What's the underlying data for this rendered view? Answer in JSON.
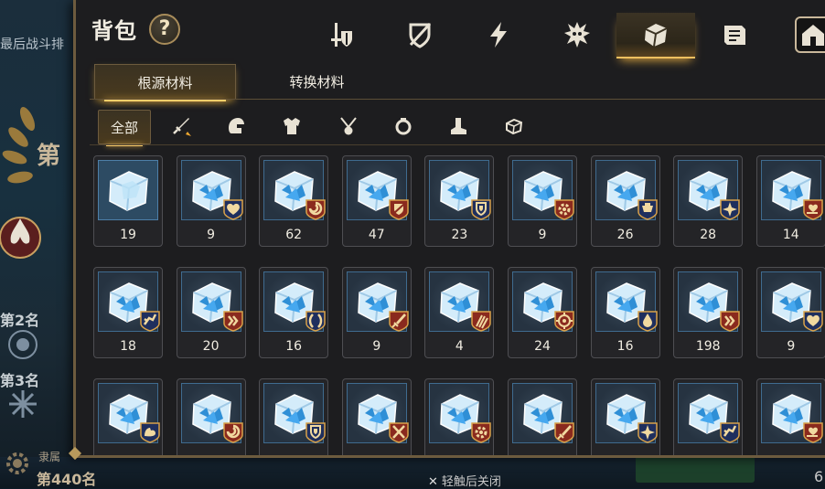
{
  "background": {
    "left_title": "最后战斗排",
    "first_place": "第",
    "rank2_label": "第2名",
    "rank3_label": "第3名",
    "self_name": "隶属",
    "self_rank": "第440名",
    "right_number": "6",
    "close_hint": "轻触后关闭"
  },
  "header": {
    "title": "背包",
    "help_label": "?",
    "tabs": [
      {
        "icon": "sword-shield-icon",
        "active": false
      },
      {
        "icon": "broken-shield-icon",
        "active": false
      },
      {
        "icon": "lightning-icon",
        "active": false
      },
      {
        "icon": "spiky-creature-icon",
        "active": false
      },
      {
        "icon": "material-cube-icon",
        "active": true
      },
      {
        "icon": "scroll-box-icon",
        "active": false
      },
      {
        "icon": "house-icon",
        "active": false
      }
    ]
  },
  "sub_tabs": [
    {
      "label": "根源材料",
      "active": true
    },
    {
      "label": "转换材料",
      "active": false
    }
  ],
  "filters": {
    "all_label": "全部",
    "icons": [
      "sword-filter-icon",
      "helmet-filter-icon",
      "armor-filter-icon",
      "necklace-filter-icon",
      "ring-filter-icon",
      "boots-filter-icon",
      "material-filter-icon"
    ]
  },
  "items": [
    {
      "count": "19",
      "badge": "none"
    },
    {
      "count": "9",
      "badge": "heart-icon"
    },
    {
      "count": "62",
      "badge": "swirl-icon"
    },
    {
      "count": "47",
      "badge": "shield-slash-icon"
    },
    {
      "count": "23",
      "badge": "shield-icon"
    },
    {
      "count": "9",
      "badge": "gear-icon"
    },
    {
      "count": "26",
      "badge": "ship-icon"
    },
    {
      "count": "28",
      "badge": "star-icon"
    },
    {
      "count": "14",
      "badge": "heart-hand-icon"
    },
    {
      "count": "18",
      "badge": "sprint-icon"
    },
    {
      "count": "20",
      "badge": "double-chevron-icon"
    },
    {
      "count": "16",
      "badge": "parry-icon"
    },
    {
      "count": "9",
      "badge": "sword-strike-icon"
    },
    {
      "count": "4",
      "badge": "claw-icon"
    },
    {
      "count": "24",
      "badge": "target-icon"
    },
    {
      "count": "16",
      "badge": "water-drop-icon"
    },
    {
      "count": "198",
      "badge": "double-chevron-icon"
    },
    {
      "count": "9",
      "badge": "heart-icon"
    },
    {
      "count": "",
      "badge": "muscle-icon"
    },
    {
      "count": "",
      "badge": "swirl-icon"
    },
    {
      "count": "",
      "badge": "shield-icon"
    },
    {
      "count": "",
      "badge": "crossed-swords-icon"
    },
    {
      "count": "",
      "badge": "gear-icon"
    },
    {
      "count": "",
      "badge": "sword-strike-icon"
    },
    {
      "count": "",
      "badge": "star-icon"
    },
    {
      "count": "",
      "badge": "sprint-icon"
    },
    {
      "count": "",
      "badge": "heart-hand-icon"
    }
  ],
  "colors": {
    "accent_gold": "#f0c060",
    "badge_red": "#8a2a1e",
    "badge_navy": "#1f2f5e",
    "badge_border": "#d9a24a"
  }
}
